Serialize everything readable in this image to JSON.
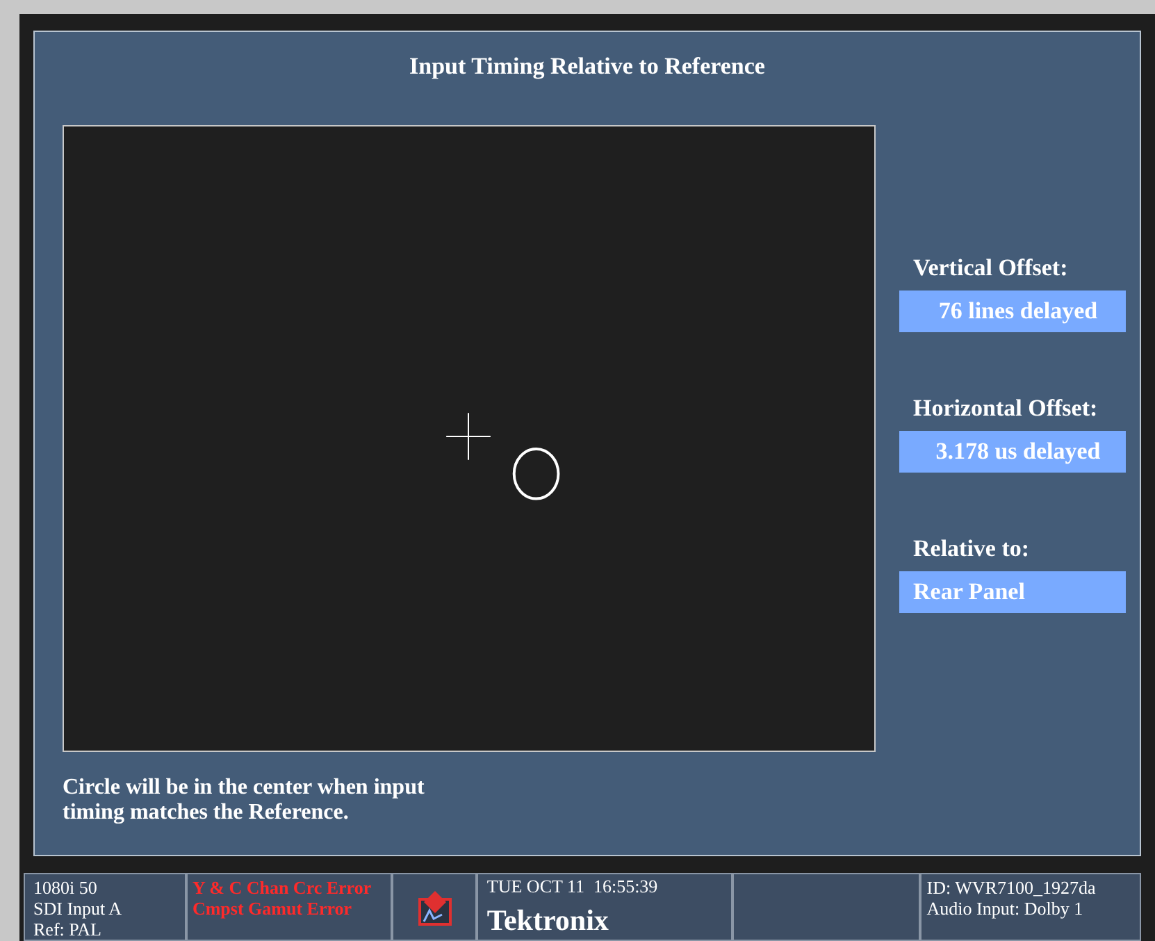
{
  "title": "Input Timing Relative to Reference",
  "readouts": [
    {
      "label": "Vertical Offset:",
      "value": "76 lines delayed",
      "kind": "reading"
    },
    {
      "label": "Horizontal Offset:",
      "value": "3.178 us delayed",
      "kind": "reading"
    },
    {
      "label": "Relative to:",
      "value": "Rear Panel",
      "kind": "setting"
    }
  ],
  "note": "Circle will be in the center when input timing matches the Reference.",
  "status_bar": {
    "format": [
      "1080i 50",
      "SDI Input A",
      "Ref: PAL"
    ],
    "errors": [
      "Y & C Chan Crc Error",
      "Cmpst Gamut Error"
    ],
    "datetime": "TUE OCT 11  16:55:39",
    "brand": "Tektronix",
    "info": [
      "ID: WVR7100_1927da",
      "Audio Input: Dolby 1"
    ]
  }
}
